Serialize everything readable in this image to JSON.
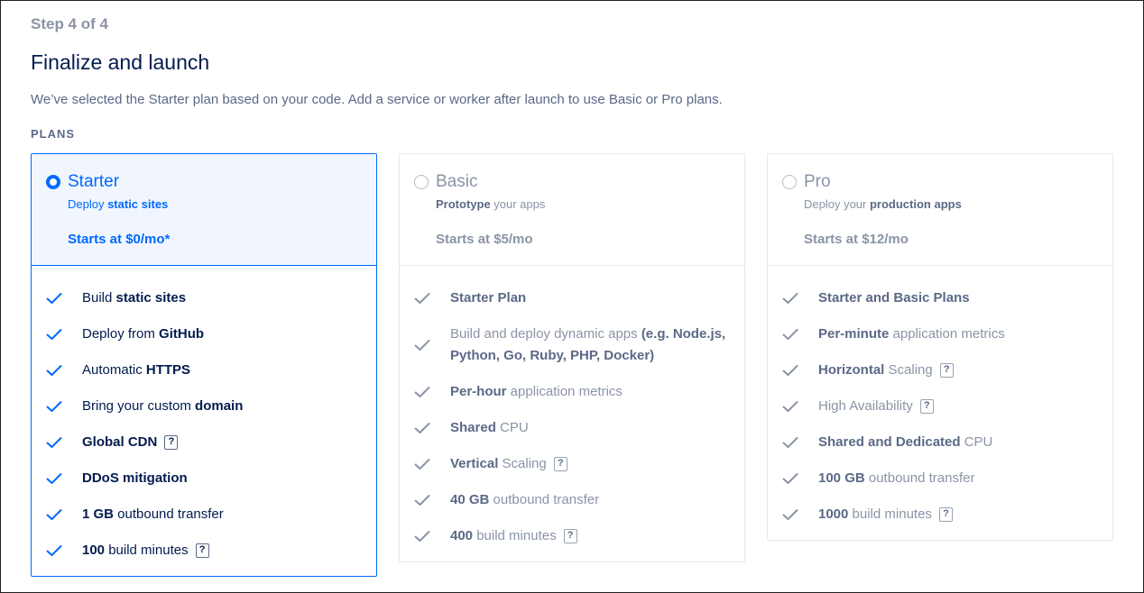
{
  "step": "Step 4 of 4",
  "title": "Finalize and launch",
  "description": "We’ve selected the Starter plan based on your code. Add a service or worker after launch to use Basic or Pro plans.",
  "plans_label": "PLANS",
  "colors": {
    "accent": "#0069ff",
    "muted": "#8a94a6",
    "text": "#031b4e"
  },
  "plans": [
    {
      "name": "Starter",
      "selected": true,
      "sub_pre": "Deploy ",
      "sub_bold": "static sites",
      "sub_post": "",
      "price": "Starts at $0/mo*",
      "features": [
        {
          "pre": "Build ",
          "bold": "static sites",
          "post": "",
          "help": false
        },
        {
          "pre": "Deploy from ",
          "bold": "GitHub",
          "post": "",
          "help": false
        },
        {
          "pre": "Automatic ",
          "bold": "HTTPS",
          "post": "",
          "help": false
        },
        {
          "pre": "Bring your custom ",
          "bold": "domain",
          "post": "",
          "help": false
        },
        {
          "pre": "",
          "bold": "Global CDN",
          "post": "",
          "help": true
        },
        {
          "pre": "",
          "bold": "DDoS mitigation",
          "post": "",
          "help": false
        },
        {
          "pre": "",
          "bold": "1 GB",
          "post": " outbound transfer",
          "help": false
        },
        {
          "pre": "",
          "bold": "100",
          "post": " build minutes",
          "help": true
        }
      ]
    },
    {
      "name": "Basic",
      "selected": false,
      "sub_pre": "",
      "sub_bold": "Prototype",
      "sub_post": " your apps",
      "price": "Starts at $5/mo",
      "features": [
        {
          "pre": "",
          "bold": "Starter Plan",
          "post": "",
          "help": false
        },
        {
          "pre": "Build and deploy dynamic apps ",
          "bold": "(e.g. Node.js, Python, Go, Ruby, PHP, Docker)",
          "post": "",
          "help": false,
          "tall": true
        },
        {
          "pre": "",
          "bold": "Per-hour",
          "post": " application metrics",
          "help": false
        },
        {
          "pre": "",
          "bold": "Shared",
          "post": " CPU",
          "help": false
        },
        {
          "pre": "",
          "bold": "Vertical",
          "post": " Scaling",
          "help": true
        },
        {
          "pre": "",
          "bold": "40 GB",
          "post": " outbound transfer",
          "help": false
        },
        {
          "pre": "",
          "bold": "400",
          "post": " build minutes",
          "help": true
        }
      ]
    },
    {
      "name": "Pro",
      "selected": false,
      "sub_pre": "Deploy your ",
      "sub_bold": "production apps",
      "sub_post": "",
      "price": "Starts at $12/mo",
      "features": [
        {
          "pre": "",
          "bold": "Starter and Basic Plans",
          "post": "",
          "help": false
        },
        {
          "pre": "",
          "bold": "Per-minute",
          "post": " application metrics",
          "help": false
        },
        {
          "pre": "",
          "bold": "Horizontal",
          "post": " Scaling",
          "help": true
        },
        {
          "pre": "High Availability",
          "bold": "",
          "post": "",
          "help": true
        },
        {
          "pre": "",
          "bold": "Shared and Dedicated",
          "post": " CPU",
          "help": false
        },
        {
          "pre": "",
          "bold": "100 GB",
          "post": " outbound transfer",
          "help": false
        },
        {
          "pre": "",
          "bold": "1000",
          "post": " build minutes",
          "help": true
        }
      ]
    }
  ],
  "help_icon_glyph": "?"
}
